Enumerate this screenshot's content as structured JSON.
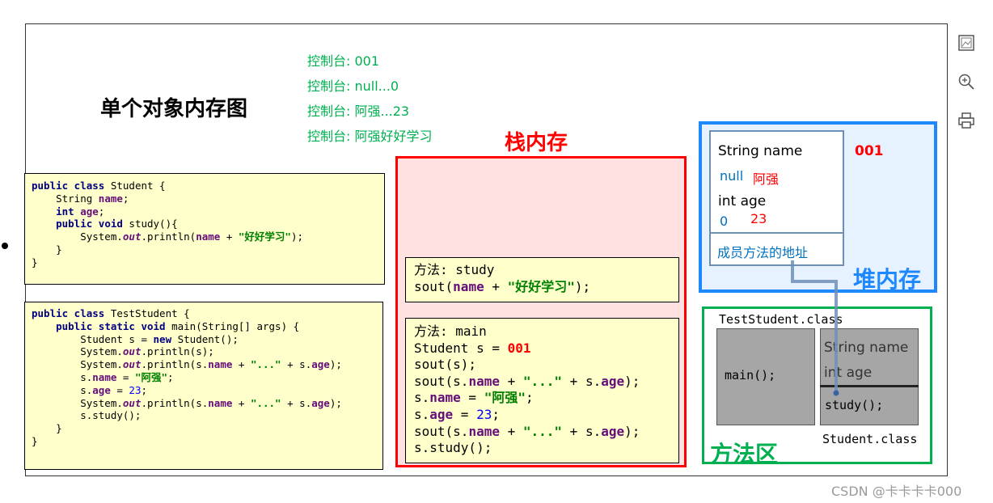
{
  "title": "单个对象内存图",
  "console_lines": [
    "控制台: 001",
    "控制台: null...0",
    "控制台: 阿强...23",
    "控制台: 阿强好好学习"
  ],
  "student_code": [
    [
      {
        "t": "public class",
        "c": "kw"
      },
      {
        "t": " Student {"
      }
    ],
    [
      {
        "t": "    String "
      },
      {
        "t": "name",
        "c": "fld"
      },
      {
        "t": ";"
      }
    ],
    [
      {
        "t": "    "
      },
      {
        "t": "int",
        "c": "kw"
      },
      {
        "t": " "
      },
      {
        "t": "age",
        "c": "fld"
      },
      {
        "t": ";"
      }
    ],
    [
      {
        "t": "    "
      },
      {
        "t": "public void",
        "c": "kw"
      },
      {
        "t": " study(){"
      }
    ],
    [
      {
        "t": "        System."
      },
      {
        "t": "out",
        "c": "it"
      },
      {
        "t": ".println("
      },
      {
        "t": "name",
        "c": "fld"
      },
      {
        "t": " + "
      },
      {
        "t": "\"好好学习\"",
        "c": "str"
      },
      {
        "t": ");"
      }
    ],
    [
      {
        "t": "    }"
      }
    ],
    [
      {
        "t": "}"
      }
    ]
  ],
  "test_code": [
    [
      {
        "t": "public class",
        "c": "kw"
      },
      {
        "t": " TestStudent {"
      }
    ],
    [
      {
        "t": "    "
      },
      {
        "t": "public static void",
        "c": "kw"
      },
      {
        "t": " main(String[] args) {"
      }
    ],
    [
      {
        "t": "        Student s = "
      },
      {
        "t": "new",
        "c": "kw"
      },
      {
        "t": " Student();"
      }
    ],
    [
      {
        "t": "        System."
      },
      {
        "t": "out",
        "c": "it"
      },
      {
        "t": ".println(s);"
      }
    ],
    [
      {
        "t": "        System."
      },
      {
        "t": "out",
        "c": "it"
      },
      {
        "t": ".println(s."
      },
      {
        "t": "name",
        "c": "fld"
      },
      {
        "t": " + "
      },
      {
        "t": "\"...\"",
        "c": "str"
      },
      {
        "t": " + s."
      },
      {
        "t": "age",
        "c": "fld"
      },
      {
        "t": ");"
      }
    ],
    [
      {
        "t": "        s."
      },
      {
        "t": "name",
        "c": "fld"
      },
      {
        "t": " = "
      },
      {
        "t": "\"阿强\"",
        "c": "str"
      },
      {
        "t": ";"
      }
    ],
    [
      {
        "t": "        s."
      },
      {
        "t": "age",
        "c": "fld"
      },
      {
        "t": " = "
      },
      {
        "t": "23",
        "c": "num"
      },
      {
        "t": ";"
      }
    ],
    [
      {
        "t": "        System."
      },
      {
        "t": "out",
        "c": "it"
      },
      {
        "t": ".println(s."
      },
      {
        "t": "name",
        "c": "fld"
      },
      {
        "t": " + "
      },
      {
        "t": "\"...\"",
        "c": "str"
      },
      {
        "t": " + s."
      },
      {
        "t": "age",
        "c": "fld"
      },
      {
        "t": ");"
      }
    ],
    [
      {
        "t": "        s.study();"
      }
    ],
    [
      {
        "t": "    }"
      }
    ],
    [
      {
        "t": "}"
      }
    ]
  ],
  "stack": {
    "label": "栈内存",
    "study_frame": [
      [
        {
          "t": "方法: study"
        }
      ],
      [
        {
          "t": "sout("
        },
        {
          "t": "name",
          "c": "fld"
        },
        {
          "t": " + "
        },
        {
          "t": "\"好好学习\"",
          "c": "str"
        },
        {
          "t": ");"
        }
      ]
    ],
    "main_frame": [
      [
        {
          "t": "方法: main"
        }
      ],
      [
        {
          "t": "Student s = "
        },
        {
          "t": "001",
          "c": "red"
        }
      ],
      [
        {
          "t": "sout(s);"
        }
      ],
      [
        {
          "t": "sout(s."
        },
        {
          "t": "name",
          "c": "fld"
        },
        {
          "t": " + "
        },
        {
          "t": "\"...\"",
          "c": "str"
        },
        {
          "t": " + s."
        },
        {
          "t": "age",
          "c": "fld"
        },
        {
          "t": ");"
        }
      ],
      [
        {
          "t": "s."
        },
        {
          "t": "name",
          "c": "fld"
        },
        {
          "t": " = "
        },
        {
          "t": "\"阿强\"",
          "c": "str"
        },
        {
          "t": ";"
        }
      ],
      [
        {
          "t": "s."
        },
        {
          "t": "age",
          "c": "fld"
        },
        {
          "t": " = "
        },
        {
          "t": "23",
          "c": "num"
        },
        {
          "t": ";"
        }
      ],
      [
        {
          "t": "sout(s."
        },
        {
          "t": "name",
          "c": "fld"
        },
        {
          "t": " + "
        },
        {
          "t": "\"...\"",
          "c": "str"
        },
        {
          "t": " + s."
        },
        {
          "t": "age",
          "c": "fld"
        },
        {
          "t": ");"
        }
      ],
      [
        {
          "t": "s.study();"
        }
      ]
    ]
  },
  "heap": {
    "label": "堆内存",
    "address": "001",
    "field_name_label": "String name",
    "name_old": "null",
    "name_new": "阿强",
    "field_age_label": "int age",
    "age_old": "0",
    "age_new": "23",
    "method_addr_label": "成员方法的地址"
  },
  "method_area": {
    "label": "方法区",
    "test_class_label": "TestStudent.class",
    "main_method": "main();",
    "student_field_name": "String name",
    "student_field_age": "int age",
    "student_method": "study();",
    "student_class_label": "Student.class"
  },
  "colors": {
    "stack": "#ff0000",
    "heap": "#1e88ff",
    "method_area": "#00b050",
    "console": "#00b050"
  },
  "toolbar": {
    "icons": [
      "image-icon",
      "zoom-in-icon",
      "print-icon"
    ]
  },
  "watermark": "CSDN @卡卡卡卡000"
}
